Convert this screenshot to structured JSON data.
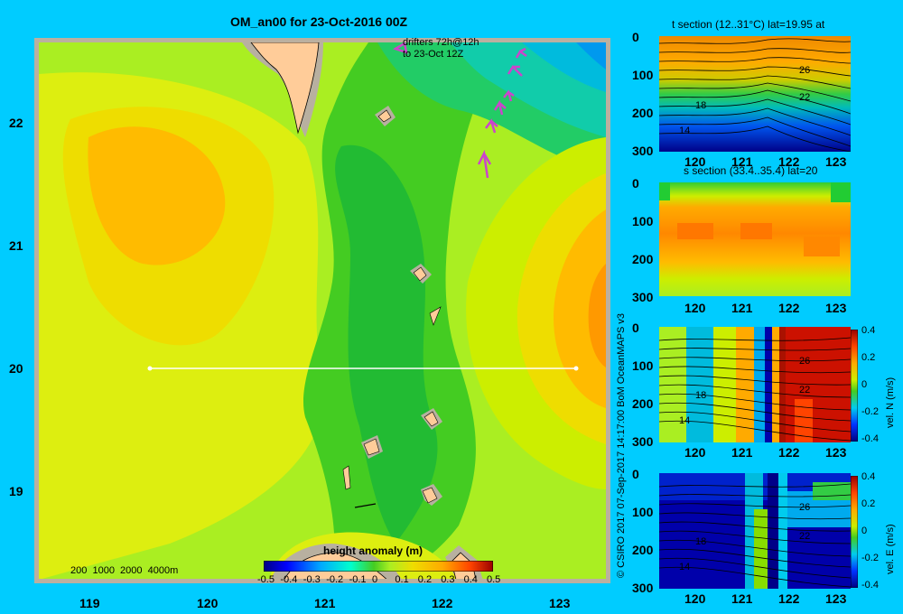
{
  "map": {
    "title": "OM_an00 for 23-Oct-2016 00Z",
    "drifters_line1": "drifters 72h@12h",
    "drifters_line2": "to 23-Oct 12Z",
    "lat_ticks": [
      "22",
      "21",
      "20",
      "19"
    ],
    "lon_ticks": [
      "119",
      "120",
      "121",
      "122",
      "123"
    ],
    "depth_legend": "200  1000  2000  4000m",
    "colorbar_title": "height anomaly  (m)",
    "colorbar_ticks": [
      "-0.5",
      "-0.4",
      "-0.3",
      "-0.2",
      "-0.1",
      "0",
      "0.1",
      "0.2",
      "0.3",
      "0.4",
      "0.5"
    ],
    "section_latitude": 20,
    "section_lon_range": [
      119.5,
      123.2
    ]
  },
  "credit": "© CSIRO 2017   07-Sep-2017 14:17:00 BoM OceanMAPS v3",
  "panels": [
    {
      "title": "t section (12..31°C) lat=19.95 at",
      "depth_ticks": [
        "0",
        "100",
        "200",
        "300"
      ],
      "lon_ticks": [
        "120",
        "121",
        "122",
        "123"
      ],
      "contour_labels": [
        "26",
        "22",
        "18",
        "14"
      ]
    },
    {
      "title": "s section (33.4..35.4) lat=20",
      "depth_ticks": [
        "0",
        "100",
        "200",
        "300"
      ],
      "lon_ticks": [
        "120",
        "121",
        "122",
        "123"
      ]
    },
    {
      "title": "",
      "depth_ticks": [
        "0",
        "100",
        "200",
        "300"
      ],
      "lon_ticks": [
        "120",
        "121",
        "122",
        "123"
      ],
      "contour_labels": [
        "26",
        "22",
        "18",
        "14"
      ],
      "colorbar_label": "vel. N  (m/s)",
      "colorbar_ticks": [
        "0.4",
        "0.2",
        "0",
        "-0.2",
        "-0.4"
      ]
    },
    {
      "title": "",
      "depth_ticks": [
        "0",
        "100",
        "200",
        "300"
      ],
      "lon_ticks": [
        "120",
        "121",
        "122",
        "123"
      ],
      "contour_labels": [
        "26",
        "22",
        "18",
        "14"
      ],
      "colorbar_label": "vel. E  (m/s)",
      "colorbar_ticks": [
        "0.4",
        "0.2",
        "0",
        "-0.2",
        "-0.4"
      ]
    }
  ],
  "colors": {
    "background": "#00ccff",
    "land": "#ffcc99",
    "shelf": "#b8b0a0",
    "drifter": "#cc44cc"
  }
}
